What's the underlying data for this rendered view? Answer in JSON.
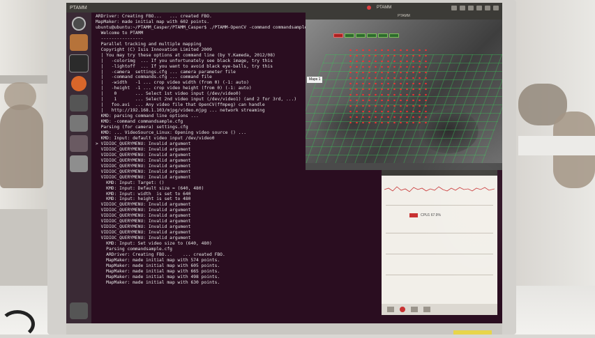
{
  "topbar": {
    "title": "PTAMM",
    "app_label": "PTAMM"
  },
  "ptam_window": {
    "title": "PTAMM",
    "map_label": "Maps 1"
  },
  "graph_window": {
    "legend": "CPU1 67.9%"
  },
  "terminal": {
    "lines": [
      "ARDriver: Creating FBO...   ... created FBO.",
      "MapMaker: made initial map with 602 points.",
      "",
      "ubuntu@ubuntu:~/PTAMM_Casper/PTAMM_Casper$ ./PTAMM-OpenCV -command commandsample.cfg",
      "  Welcome to PTAMM",
      "  ----------------",
      "  Parallel tracking and multiple mapping",
      "  Copyright (C) Isis Innovation Limited 2009",
      "",
      "  | You may try these options at command line (by Y.Kameda, 2012/08)",
      "  |   -colorimg  ... If you unfortunately see black image, try this",
      "  |   -lightoff  ... If you want to avoid black eye-balls, try this",
      "  |   -camera  settings.cfg ... camera parameter file",
      "  |   -command commands.cfg ... command file",
      "  |   -width   -1 ... crop video width (from 0) (-1: auto)",
      "  |   -height  -1 ... crop video height (from 0) (-1: auto)",
      "  |    0       ... Select 1st video input (/dev/video0)",
      "  |    1       ... Select 2nd video input (/dev/video1) (and 2 for 3rd, ...)",
      "  |   foo.avi  ... Any video file that OpenCV(ffmpeg) can handle",
      "  |   http://192.168.1.103/mjpg/video.mjpg ... network streaming",
      "",
      "  KMD: parsing command line options ...",
      "  KMD: -command commandsample.cfg",
      "  Parsing (for camera) settings.cfg",
      "  KMD: ... VideoSource_Linux: Opening video source () ...",
      "  KMD: Input: default video input /dev/video0",
      "> VIDIOC_QUERYMENU: Invalid argument",
      "  VIDIOC_QUERYMENU: Invalid argument",
      "  VIDIOC_QUERYMENU: Invalid argument",
      "  VIDIOC_QUERYMENU: Invalid argument",
      "  VIDIOC_QUERYMENU: Invalid argument",
      "  VIDIOC_QUERYMENU: Invalid argument",
      "  VIDIOC_QUERYMENU: Invalid argument",
      "    KMD: Input: Target: ()",
      "    KMD: Input: Default size = (640, 480)",
      "    KMD: Input: width  is set to 640",
      "    KMD: Input: height is set to 480",
      "  VIDIOC_QUERYMENU: Invalid argument",
      "  VIDIOC_QUERYMENU: Invalid argument",
      "  VIDIOC_QUERYMENU: Invalid argument",
      "  VIDIOC_QUERYMENU: Invalid argument",
      "  VIDIOC_QUERYMENU: Invalid argument",
      "  VIDIOC_QUERYMENU: Invalid argument",
      "  VIDIOC_QUERYMENU: Invalid argument",
      "    KMD: Input: Set video size to (640, 480)",
      "    Parsing commandsample.cfg",
      "    ARDriver: Creating FBO...    ... created FBO.",
      "    MapMaker: made initial map with 574 points.",
      "    MapMaker: made initial map with 605 points.",
      "    MapMaker: made initial map with 665 points.",
      "    MapMaker: made initial map with 498 points.",
      "    MapMaker: made initial map with 630 points.",
      ""
    ]
  },
  "icons": {
    "launcher": [
      "dash-icon",
      "files-icon",
      "terminal-icon",
      "firefox-icon",
      "system-monitor-icon",
      "settings-icon",
      "disk-icon",
      "workspace-icon",
      "trash-icon"
    ]
  }
}
